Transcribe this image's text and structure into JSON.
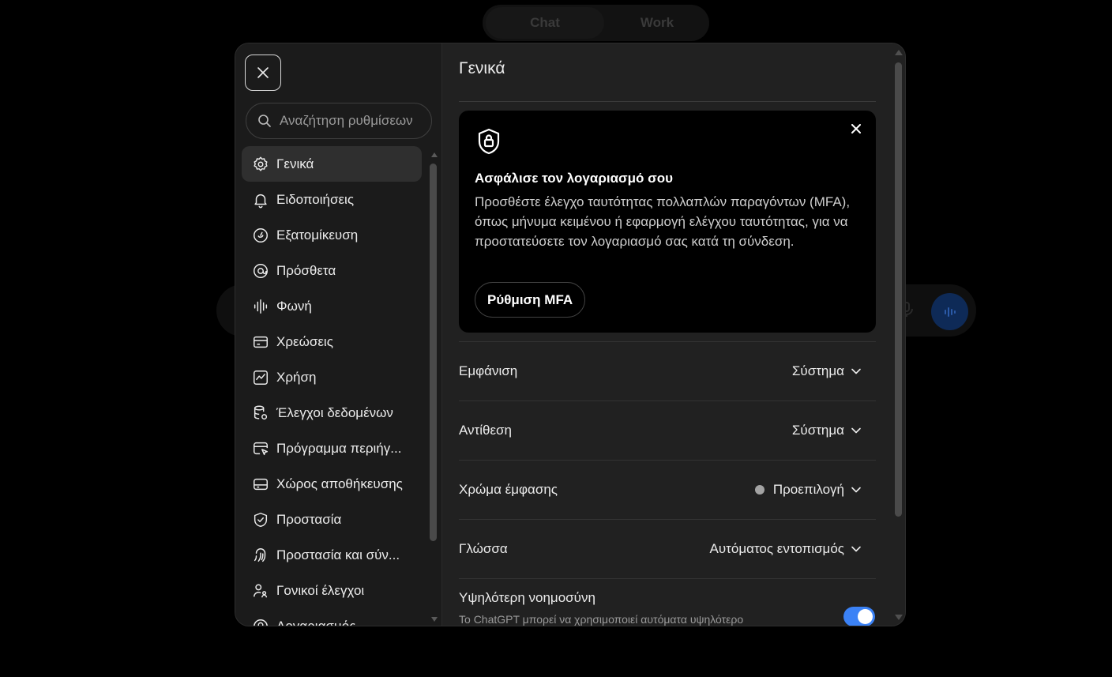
{
  "background": {
    "tabs": [
      "Chat",
      "Work"
    ]
  },
  "search": {
    "placeholder": "Αναζήτηση ρυθμίσεων"
  },
  "sidebar": {
    "items": [
      {
        "label": "Γενικά",
        "icon": "gear-icon"
      },
      {
        "label": "Ειδοποιήσεις",
        "icon": "bell-icon"
      },
      {
        "label": "Εξατομίκευση",
        "icon": "personalization-icon"
      },
      {
        "label": "Πρόσθετα",
        "icon": "apps-icon"
      },
      {
        "label": "Φωνή",
        "icon": "voice-wave-icon"
      },
      {
        "label": "Χρεώσεις",
        "icon": "credit-card-icon"
      },
      {
        "label": "Χρήση",
        "icon": "usage-chart-icon"
      },
      {
        "label": "Έλεγχοι δεδομένων",
        "icon": "database-gear-icon"
      },
      {
        "label": "Πρόγραμμα περιήγ...",
        "icon": "browser-cursor-icon"
      },
      {
        "label": "Χώρος αποθήκευσης",
        "icon": "storage-drive-icon"
      },
      {
        "label": "Προστασία",
        "icon": "shield-check-icon"
      },
      {
        "label": "Προστασία και σύν...",
        "icon": "fingerprint-icon"
      },
      {
        "label": "Γονικοί έλεγχοι",
        "icon": "parental-user-icon"
      },
      {
        "label": "Λογαριασμός",
        "icon": "account-icon"
      }
    ]
  },
  "main": {
    "title": "Γενικά",
    "mfa_card": {
      "title": "Ασφάλισε τον λογαριασμό σου",
      "text": "Προσθέστε έλεγχο ταυτότητας πολλαπλών παραγόντων (MFA), όπως μήνυμα κειμένου ή εφαρμογή ελέγχου ταυτότητας, για να προστατεύσετε τον λογαριασμό σας κατά τη σύνδεση.",
      "button": "Ρύθμιση MFA"
    },
    "settings": [
      {
        "label": "Εμφάνιση",
        "value": "Σύστημα"
      },
      {
        "label": "Αντίθεση",
        "value": "Σύστημα"
      },
      {
        "label": "Χρώμα έμφασης",
        "value": "Προεπιλογή"
      },
      {
        "label": "Γλώσσα",
        "value": "Αυτόματος εντοπισμός"
      }
    ],
    "intelligence": {
      "title": "Υψηλότερη νοημοσύνη",
      "subtitle": "Το ChatGPT μπορεί να χρησιμοποιεί αυτόματα υψηλότερο",
      "enabled": true
    }
  },
  "colors": {
    "accent": "#3b82f6",
    "accent_dot": "#a3a3a3"
  }
}
